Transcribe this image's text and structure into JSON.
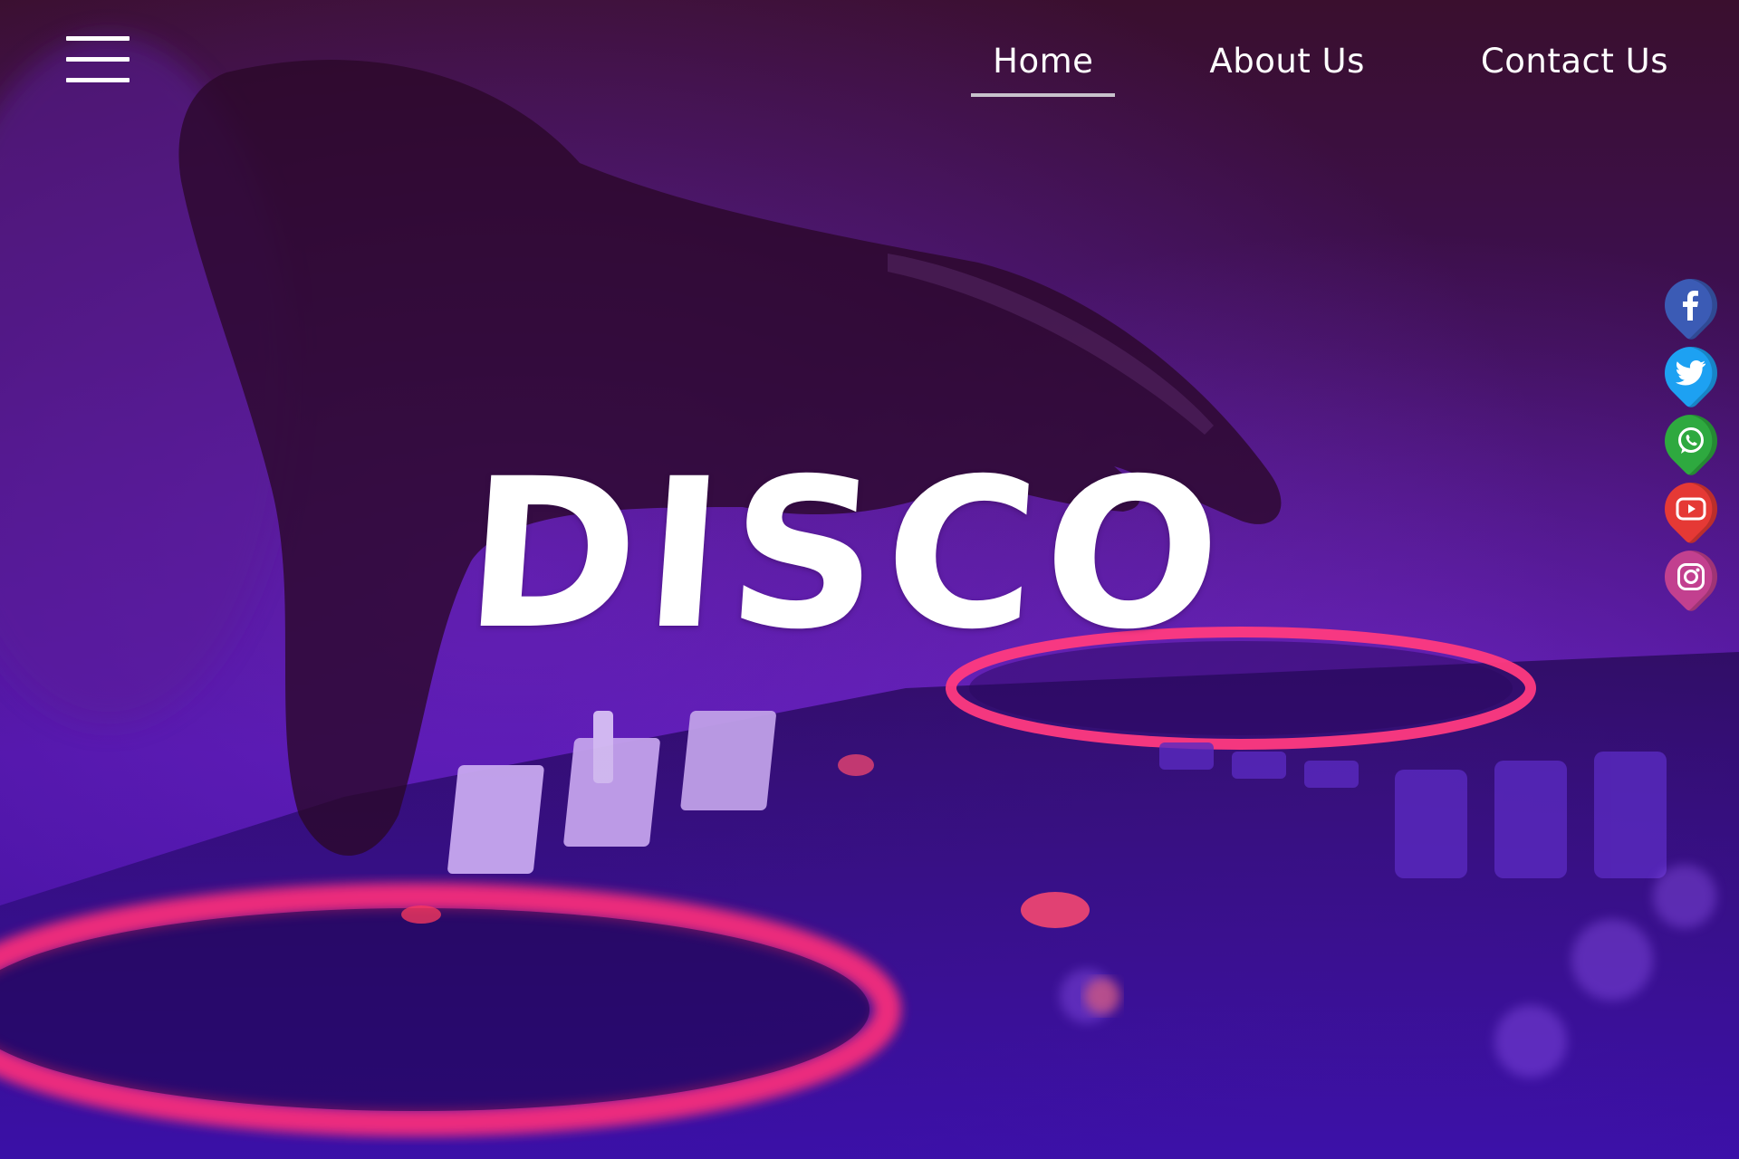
{
  "nav": {
    "items": [
      {
        "label": "Home",
        "active": true
      },
      {
        "label": "About Us",
        "active": false
      },
      {
        "label": "Contact Us",
        "active": false
      }
    ]
  },
  "hero": {
    "title": "DISCO"
  },
  "social": {
    "items": [
      {
        "icon": "facebook-icon",
        "color": "#3b5bb5"
      },
      {
        "icon": "twitter-icon",
        "color": "#1da1f2"
      },
      {
        "icon": "whatsapp-icon",
        "color": "#2ea93f"
      },
      {
        "icon": "youtube-icon",
        "color": "#e53935"
      },
      {
        "icon": "instagram-icon",
        "color": "#c2408f"
      }
    ]
  },
  "theme": {
    "accent": "#ff2a6d",
    "background": "#3d0f55",
    "text": "#ffffff",
    "underline": "#c8c2cc"
  }
}
